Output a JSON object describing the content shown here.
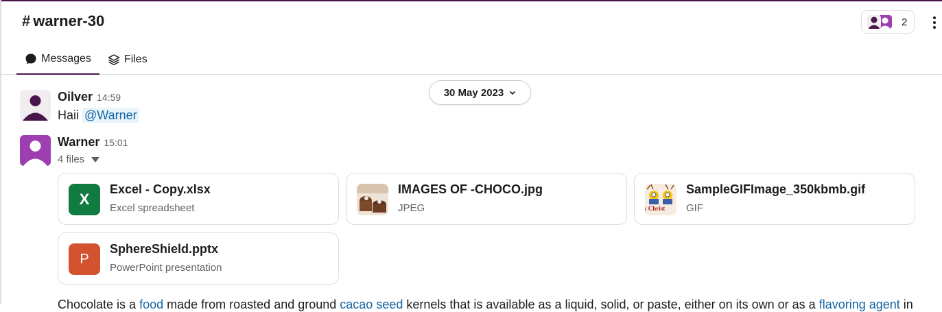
{
  "channel": {
    "hash": "#",
    "name": "warner-30"
  },
  "members": {
    "count": "2"
  },
  "tabs": [
    {
      "label": "Messages",
      "icon": "chat-bubble-icon",
      "active": true
    },
    {
      "label": "Files",
      "icon": "layers-icon",
      "active": false
    }
  ],
  "date_divider": {
    "label": "30 May 2023"
  },
  "messages": [
    {
      "sender": "Oilver",
      "time": "14:59",
      "text": "Haii",
      "mention": "@Warner"
    },
    {
      "sender": "Warner",
      "time": "15:01",
      "files_label": "4 files"
    }
  ],
  "files": [
    {
      "name": "Excel - Copy.xlsx",
      "type": "Excel spreadsheet",
      "badge": "X",
      "color": "#107c41"
    },
    {
      "name": "IMAGES OF -CHOCO.jpg",
      "type": "JPEG"
    },
    {
      "name": "SampleGIFImage_350kbmb.gif",
      "type": "GIF",
      "thumb_text": "y Christ"
    },
    {
      "name": "SphereShield.pptx",
      "type": "PowerPoint presentation",
      "badge": "P",
      "color": "#d35230"
    }
  ],
  "paragraph": {
    "t1": "Chocolate is a ",
    "l1": "food",
    "t2": " made from roasted and ground ",
    "l2": "cacao seed",
    "t3": " kernels that is available as a liquid, solid, or paste, either on its own or as a ",
    "l3": "flavoring agent",
    "t4": " in"
  },
  "colors": {
    "accent": "#4a154b",
    "link": "#1264a3",
    "avatar_purple": "#9d3fb0"
  }
}
